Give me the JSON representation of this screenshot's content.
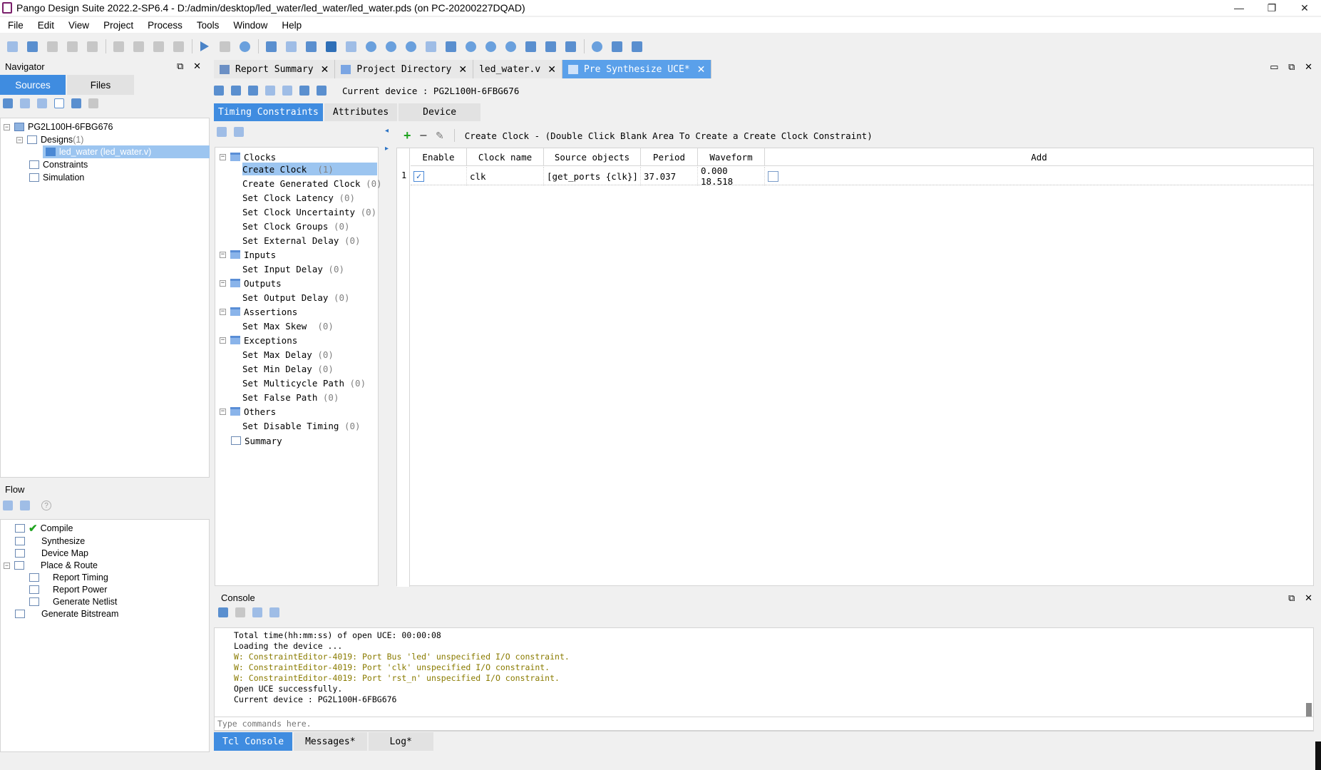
{
  "window": {
    "title": "Pango Design Suite 2022.2-SP6.4 - D:/admin/desktop/led_water/led_water/led_water.pds (on PC-20200227DQAD)",
    "minimize": "—",
    "restore": "❐",
    "close": "✕"
  },
  "menu": [
    "File",
    "Edit",
    "View",
    "Project",
    "Process",
    "Tools",
    "Window",
    "Help"
  ],
  "navigator": {
    "title": "Navigator",
    "float_icon": "⧉",
    "close_icon": "✕",
    "tabs": {
      "sources": "Sources",
      "files": "Files"
    },
    "tree": {
      "device": "PG2L100H-6FBG676",
      "designs": "Designs",
      "designs_count": "(1)",
      "top_module": "led_water (led_water.v)",
      "constraints": "Constraints",
      "simulation": "Simulation"
    }
  },
  "flow": {
    "title": "Flow",
    "help_icon": "?",
    "steps": {
      "compile": "Compile",
      "synthesize": "Synthesize",
      "device_map": "Device Map",
      "place_route": "Place & Route",
      "report_timing": "Report Timing",
      "report_power": "Report Power",
      "generate_netlist": "Generate Netlist",
      "generate_bitstream": "Generate Bitstream"
    }
  },
  "editor_tabs": [
    {
      "label": "Report Summary",
      "active": false
    },
    {
      "label": "Project Directory",
      "active": false
    },
    {
      "label": "led_water.v",
      "active": false
    },
    {
      "label": "Pre Synthesize UCE*",
      "active": true
    }
  ],
  "uce": {
    "current_device": "Current device : PG2L100H-6FBG676",
    "subtabs": {
      "timing": "Timing Constraints",
      "attributes": "Attributes",
      "device": "Device"
    },
    "tree": {
      "clocks": "Clocks",
      "create_clock": "Create Clock",
      "create_clock_count": "(1)",
      "create_generated_clock": "Create Generated Clock",
      "set_clock_latency": "Set Clock Latency",
      "set_clock_uncertainty": "Set Clock Uncertainty",
      "set_clock_groups": "Set Clock Groups",
      "set_external_delay": "Set External Delay",
      "inputs": "Inputs",
      "set_input_delay": "Set Input Delay",
      "outputs": "Outputs",
      "set_output_delay": "Set Output Delay",
      "assertions": "Assertions",
      "set_max_skew": "Set Max Skew",
      "exceptions": "Exceptions",
      "set_max_delay": "Set Max Delay",
      "set_min_delay": "Set Min Delay",
      "set_multicycle_path": "Set Multicycle Path",
      "set_false_path": "Set False Path",
      "others": "Others",
      "set_disable_timing": "Set Disable Timing",
      "summary": "Summary",
      "zero": "(0)"
    },
    "grid_description": "Create Clock - (Double Click Blank Area To Create a Create Clock Constraint)",
    "columns": [
      "Enable",
      "Clock name",
      "Source objects",
      "Period",
      "Waveform",
      "Add"
    ],
    "rows": [
      {
        "index": "1",
        "enable_mark": "✓",
        "clock_name": "clk",
        "source_objects": "[get_ports {clk}]",
        "period": "37.037",
        "waveform": "0.000 18.518"
      }
    ]
  },
  "console": {
    "title": "Console",
    "lines": [
      {
        "text": "Total time(hh:mm:ss) of open UCE: 00:00:08",
        "kind": "info"
      },
      {
        "text": "Loading the device ...",
        "kind": "info"
      },
      {
        "text": "W: ConstraintEditor-4019: Port Bus 'led' unspecified I/O constraint.",
        "kind": "warn"
      },
      {
        "text": "W: ConstraintEditor-4019: Port 'clk' unspecified I/O constraint.",
        "kind": "warn"
      },
      {
        "text": "W: ConstraintEditor-4019: Port 'rst_n' unspecified I/O constraint.",
        "kind": "warn"
      },
      {
        "text": "Open UCE successfully.",
        "kind": "info"
      },
      {
        "text": "Current device : PG2L100H-6FBG676",
        "kind": "info"
      }
    ],
    "input_placeholder": "Type commands here.",
    "tabs": {
      "tcl": "Tcl Console",
      "messages": "Messages*",
      "log": "Log*"
    }
  },
  "colors": {
    "accent": "#3f8ce0",
    "selection": "#9cc5f0",
    "warning": "#8a7b00",
    "check": "#1fa31f"
  }
}
